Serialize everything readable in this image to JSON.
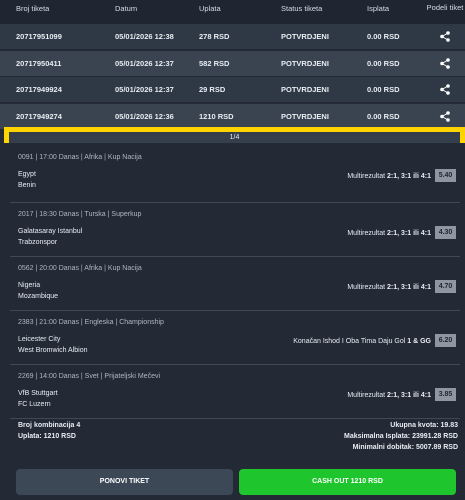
{
  "table": {
    "headers": {
      "ticket_id": "Broj tiketa",
      "date": "Datum",
      "stake": "Uplata",
      "status": "Status tiketa",
      "payout": "Isplata",
      "share": "Podeli tiket"
    },
    "rows": [
      {
        "ticket_id": "20717951099",
        "date": "05/01/2026 12:38",
        "stake": "278 RSD",
        "status": "POTVRDJENI",
        "payout": "0.00 RSD"
      },
      {
        "ticket_id": "20717950411",
        "date": "05/01/2026 12:37",
        "stake": "582 RSD",
        "status": "POTVRDJENI",
        "payout": "0.00 RSD"
      },
      {
        "ticket_id": "20717949924",
        "date": "05/01/2026 12:37",
        "stake": "29 RSD",
        "status": "POTVRDJENI",
        "payout": "0.00 RSD"
      },
      {
        "ticket_id": "20717949274",
        "date": "05/01/2026 12:36",
        "stake": "1210 RSD",
        "status": "POTVRDJENI",
        "payout": "0.00 RSD"
      }
    ]
  },
  "pager": {
    "label": "1/4"
  },
  "matches": [
    {
      "meta": "0091 | 17:00 Danas | Afrika | Kup Nacija",
      "home": "Egypt",
      "away": "Benin",
      "market": "Multirezultat",
      "pick": "2:1, 3:1 ili 4:1",
      "odd": "5.40"
    },
    {
      "meta": "2017 | 18:30 Danas | Turska | Superkup",
      "home": "Galatasaray Istanbul",
      "away": "Trabzonspor",
      "market": "Multirezultat",
      "pick": "2:1, 3:1 ili 4:1",
      "odd": "4.30"
    },
    {
      "meta": "0562 | 20:00 Danas | Afrika | Kup Nacija",
      "home": "Nigeria",
      "away": "Mozambique",
      "market": "Multirezultat",
      "pick": "2:1, 3:1 ili 4:1",
      "odd": "4.70"
    },
    {
      "meta": "2383 | 21:00 Danas | Engleska | Championship",
      "home": "Leicester City",
      "away": "West Bromwich Albion",
      "market": "Konačan Ishod I Oba Tima Daju Gol",
      "pick": "1 & GG",
      "odd": "6.20"
    },
    {
      "meta": "2269 | 14:00 Danas | Svet | Prijateljski Mečevi",
      "home": "VfB Stuttgart",
      "away": "FC Luzern",
      "market": "Multirezultat",
      "pick": "2:1, 3:1 ili 4:1",
      "odd": "3.85"
    }
  ],
  "summary": {
    "combinations": "Broj kombinacija 4",
    "stake": "Uplata: 1210 RSD",
    "total_odds": "Ukupna kvota: 19.83",
    "max_payout": "Maksimalna Isplata: 23991.28 RSD",
    "min_win": "Minimalni dobitak: 5007.89 RSD"
  },
  "buttons": {
    "repeat": "PONOVI TIKET",
    "cashout": "CASH OUT 1210 RSD"
  },
  "icons": {
    "share": "share-icon"
  },
  "colors": {
    "accent_yellow": "#ffd400",
    "cashout_green": "#1fc52c",
    "odd_badge": "#8e96a1"
  }
}
